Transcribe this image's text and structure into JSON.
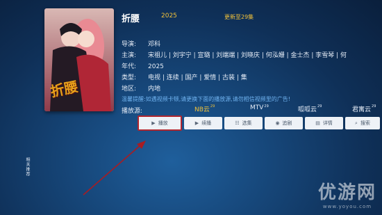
{
  "show": {
    "title": "折腰",
    "year": "2025",
    "update": "更新至29集",
    "poster_text": "折腰"
  },
  "details": [
    {
      "label": "导演:",
      "value": "邓科"
    },
    {
      "label": "主演:",
      "value": "宋祖儿 | 刘宇宁 | 宣璐 | 刘端端 | 刘晓庆 | 何泓姗 | 金士杰 | 李雪琴 | 何"
    },
    {
      "label": "年代:",
      "value": "2025"
    },
    {
      "label": "类型:",
      "value": "电视 | 连续 | 国产 | 爱情 | 古装 | 集"
    },
    {
      "label": "地区:",
      "value": "内地"
    }
  ],
  "tip": "温馨提醒:如遇视频卡顿,请更换下面的播放源,请勿相信视频里的广告!",
  "sources_label": "播放源:",
  "sources": [
    {
      "name": "NB云",
      "count": "29",
      "active": true
    },
    {
      "name": "MTV",
      "count": "29",
      "active": false
    },
    {
      "name": "呱呱云",
      "count": "29",
      "active": false
    },
    {
      "name": "君寓云",
      "count": "29",
      "active": false
    }
  ],
  "buttons": [
    {
      "label": "播放",
      "icon": "play-icon",
      "glyph": "▶"
    },
    {
      "label": "续播",
      "icon": "resume-icon",
      "glyph": "▶"
    },
    {
      "label": "选集",
      "icon": "episodes-icon",
      "glyph": "☷"
    },
    {
      "label": "追剧",
      "icon": "follow-icon",
      "glyph": "◉"
    },
    {
      "label": "详情",
      "icon": "details-icon",
      "glyph": "▤"
    },
    {
      "label": "搜索",
      "icon": "search-icon",
      "glyph": "⌕"
    }
  ],
  "side_label": "相关推荐",
  "watermark": {
    "main": "优游网",
    "sub": "www.yoyou.com"
  },
  "colors": {
    "accent": "#f2c23a",
    "tip": "#6fb2ef",
    "highlight": "#b0262f"
  }
}
